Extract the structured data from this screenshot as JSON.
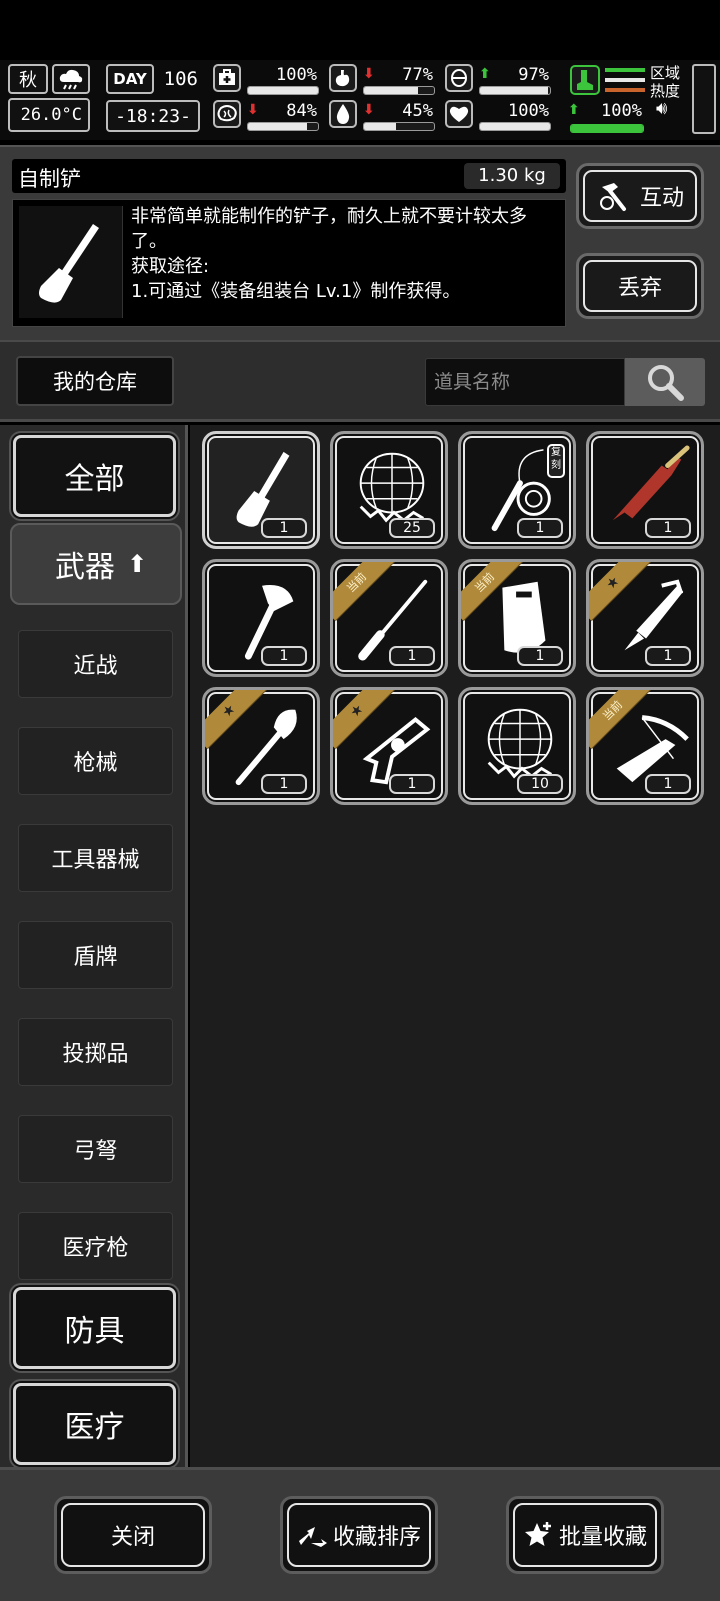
{
  "status": {
    "season": "秋",
    "temperature": "26.0°C",
    "day_label": "DAY",
    "day_number": "106",
    "clock": "-18:23-",
    "stats": [
      {
        "name": "health",
        "icon": "medkit-icon",
        "value": "100%",
        "level": 1.0,
        "trend": ""
      },
      {
        "name": "hunger",
        "icon": "stomach-icon",
        "value": "77%",
        "level": 0.77,
        "trend": "down"
      },
      {
        "name": "stamina",
        "icon": "lungs-icon",
        "value": "97%",
        "level": 0.97,
        "trend": "up"
      },
      {
        "name": "sanity",
        "icon": "brain-icon",
        "value": "84%",
        "level": 0.84,
        "trend": "down"
      },
      {
        "name": "thirst",
        "icon": "water-drop-icon",
        "value": "45%",
        "level": 0.45,
        "trend": "down"
      },
      {
        "name": "mood",
        "icon": "heart-icon",
        "value": "100%",
        "level": 1.0,
        "trend": ""
      }
    ],
    "leg_stat": {
      "value": "100%",
      "level": 1.0,
      "trend": "up",
      "accent": "#3cc43c"
    },
    "area_heat_label_1": "区域",
    "area_heat_label_2": "热度"
  },
  "item": {
    "name": "自制铲",
    "weight": "1.30 kg",
    "description": "非常简单就能制作的铲子，耐久上就不要计较太多了。\n获取途径:\n1.可通过《装备组装台 Lv.1》制作获得。",
    "interact_label": "互动",
    "discard_label": "丢弃"
  },
  "warehouse": {
    "title": "我的仓库",
    "search_placeholder": "道具名称"
  },
  "categories": {
    "all": "全部",
    "weapons": "武器",
    "subcategories": [
      "近战",
      "枪械",
      "工具器械",
      "盾牌",
      "投掷品",
      "弓弩",
      "医疗枪"
    ],
    "armor": "防具",
    "medical": "医疗"
  },
  "items": [
    {
      "icon": "shovel-icon",
      "count": "1",
      "badge": "",
      "selected": true
    },
    {
      "icon": "net-trap-icon",
      "count": "25",
      "badge": ""
    },
    {
      "icon": "whip-icon",
      "count": "1",
      "badge": "",
      "copy_tag": "复刻"
    },
    {
      "icon": "rifle-icon",
      "count": "1",
      "badge": ""
    },
    {
      "icon": "axe-icon",
      "count": "1",
      "badge": ""
    },
    {
      "icon": "spear-icon",
      "count": "1",
      "badge": "当前"
    },
    {
      "icon": "riot-shield-icon",
      "count": "1",
      "badge": "当前"
    },
    {
      "icon": "machete-icon",
      "count": "1",
      "badge": "★"
    },
    {
      "icon": "spade-icon",
      "count": "1",
      "badge": "★"
    },
    {
      "icon": "revolver-icon",
      "count": "1",
      "badge": "★"
    },
    {
      "icon": "net-trap-icon",
      "count": "10",
      "badge": ""
    },
    {
      "icon": "crossbow-icon",
      "count": "1",
      "badge": "当前"
    }
  ],
  "bottom": {
    "close_label": "关闭",
    "sort_label": "收藏排序",
    "batch_label": "批量收藏"
  }
}
